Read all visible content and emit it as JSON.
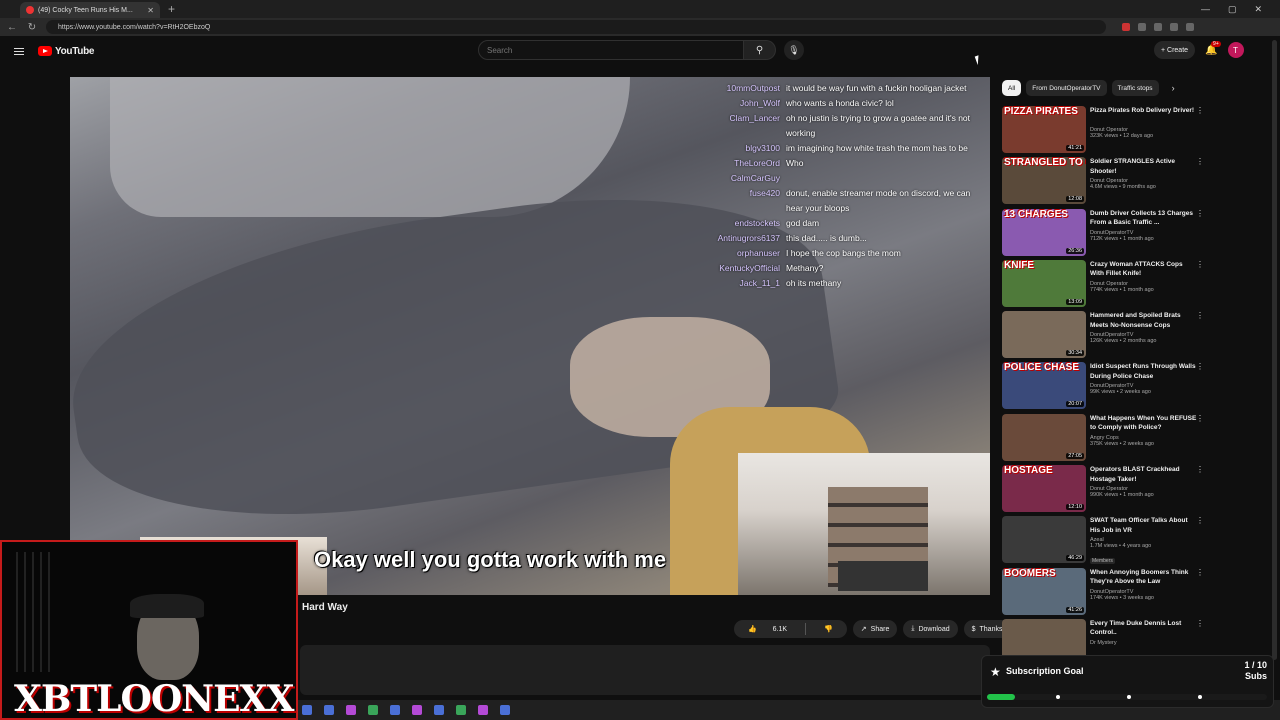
{
  "browser": {
    "tab_title": "(49) Cocky Teen Runs His M...",
    "url": "https://www.youtube.com/watch?v=RtH2OEbzoQ",
    "window_controls": [
      "—",
      "▢",
      "✕"
    ]
  },
  "header": {
    "logo_text": "YouTube",
    "search_placeholder": "Search",
    "create_label": "+ Create",
    "notification_count": "9+",
    "avatar_letter": "T"
  },
  "video": {
    "caption": "Okay well you gotta work with me",
    "title_fragment": "Hard Way",
    "chat": [
      {
        "user": "10mmOutpost",
        "msg": "it would be way fun with a fuckin hooligan jacket"
      },
      {
        "user": "John_Wolf",
        "msg": "who wants a honda civic? lol"
      },
      {
        "user": "Clam_Lancer",
        "msg": "oh no justin is trying to grow a goatee and it's not working"
      },
      {
        "user": "blgv3100",
        "msg": "im imagining how white trash the mom has to be"
      },
      {
        "user": "TheLoreOrd",
        "msg": "Who"
      },
      {
        "user": "CalmCarGuy",
        "msg": ""
      },
      {
        "user": "fuse420",
        "msg": "donut, enable streamer mode on discord, we can hear your bloops"
      },
      {
        "user": "endstockets",
        "msg": "god dam"
      },
      {
        "user": "Antinugrors6137",
        "msg": "this dad..... is dumb..."
      },
      {
        "user": "orphanuser",
        "msg": "I hope the cop bangs the mom"
      },
      {
        "user": "KentuckyOfficial",
        "msg": "Methany?"
      },
      {
        "user": "Jack_11_1",
        "msg": "oh its methany"
      }
    ]
  },
  "actions": {
    "likes": "6.1K",
    "share": "Share",
    "download": "Download",
    "thanks": "Thanks"
  },
  "streamer_logo": "XBTLOONEXX",
  "sidebar": {
    "chips": [
      "All",
      "From DonutOperatorTV",
      "Traffic stops"
    ],
    "recommendations": [
      {
        "thumb_text": "PIZZA PIRATES",
        "title": "Pizza Pirates Rob Delivery Driver!",
        "channel": "Donut Operator",
        "meta": "323K views • 12 days ago",
        "duration": "41:21",
        "color": "#7a3b2e"
      },
      {
        "thumb_text": "STRANGLED TO DEATH",
        "title": "Soldier STRANGLES Active Shooter!",
        "channel": "Donut Operator",
        "meta": "4.6M views • 9 months ago",
        "duration": "12:08",
        "color": "#5a4a3a"
      },
      {
        "thumb_text": "13 CHARGES",
        "title": "Dumb Driver Collects 13 Charges From a Basic Traffic ...",
        "channel": "DonutOperatorTV",
        "meta": "712K views • 1 month ago",
        "duration": "26:36",
        "color": "#8a5ab0"
      },
      {
        "thumb_text": "KNIFE",
        "title": "Crazy Woman ATTACKS Cops With Fillet Knife!",
        "channel": "Donut Operator",
        "meta": "774K views • 1 month ago",
        "duration": "13:09",
        "color": "#4f7a3a"
      },
      {
        "thumb_text": "",
        "title": "Hammered and Spoiled Brats Meets No-Nonsense Cops",
        "channel": "DonutOperatorTV",
        "meta": "126K views • 2 months ago",
        "duration": "30:34",
        "color": "#7a6a5a"
      },
      {
        "thumb_text": "POLICE CHASE",
        "title": "Idiot Suspect Runs Through Walls During Police Chase",
        "channel": "DonutOperatorTV",
        "meta": "99K views • 2 weeks ago",
        "duration": "20:07",
        "color": "#3a4a7a"
      },
      {
        "thumb_text": "",
        "title": "What Happens When You REFUSE to Comply with Police?",
        "channel": "Angry Cops",
        "meta": "375K views • 2 weeks ago",
        "duration": "27:05",
        "color": "#6a4a3a"
      },
      {
        "thumb_text": "HOSTAGE",
        "title": "Operators BLAST Crackhead Hostage Taker!",
        "channel": "Donut Operator",
        "meta": "990K views • 1 month ago",
        "duration": "12:10",
        "color": "#7a2a4a"
      },
      {
        "thumb_text": "",
        "title": "SWAT Team Officer Talks About His Job in VR",
        "channel": "Azeal",
        "meta": "1.7M views • 4 years ago",
        "duration": "46:29",
        "badge": "Members",
        "color": "#3a3a3a"
      },
      {
        "thumb_text": "BOOMERS",
        "title": "When Annoying Boomers Think They're Above the Law",
        "channel": "DonutOperatorTV",
        "meta": "174K views • 3 weeks ago",
        "duration": "41:26",
        "color": "#5a6a7a"
      },
      {
        "thumb_text": "",
        "title": "Every Time Duke Dennis Lost Control..",
        "channel": "Dr Mystery",
        "meta": "",
        "duration": "",
        "color": "#6a5a4a"
      }
    ]
  },
  "subscription_goal": {
    "title": "Subscription Goal",
    "count": "1 / 10",
    "unit": "Subs",
    "progress": 0.1,
    "accent": "#22c34a"
  }
}
